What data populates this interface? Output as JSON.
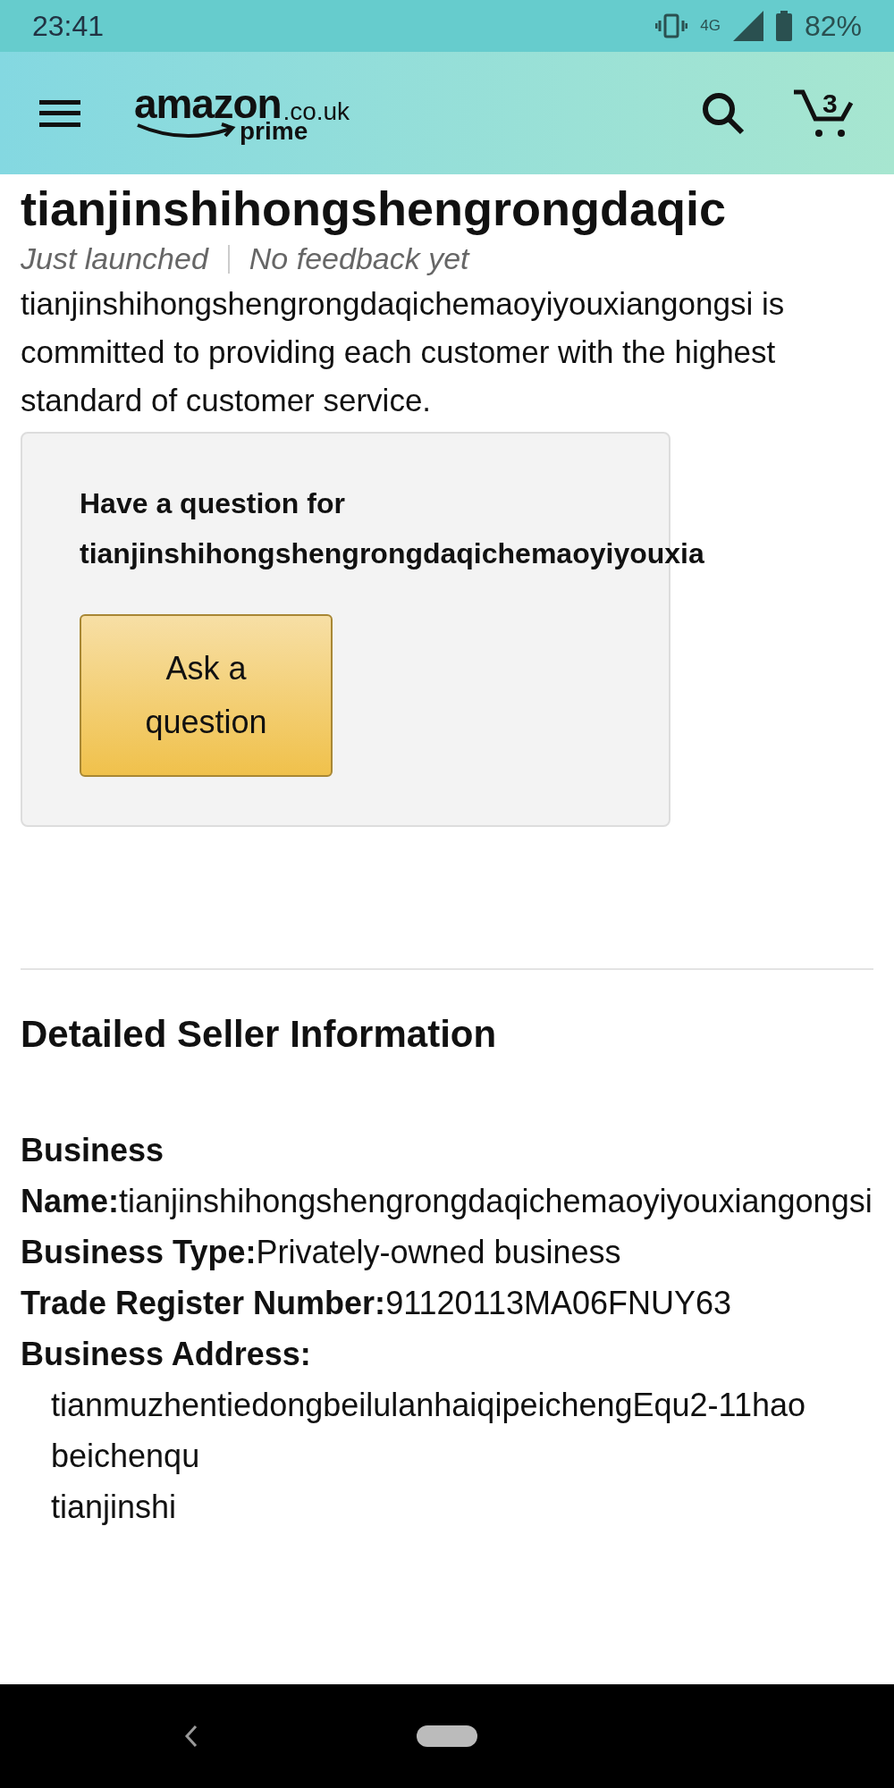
{
  "status_bar": {
    "time": "23:41",
    "network": "4G",
    "battery": "82%"
  },
  "header": {
    "logo": "amazon",
    "logo_domain": ".co.uk",
    "logo_sub": "prime",
    "cart_count": "3"
  },
  "seller": {
    "title": "tianjinshihongshengrongdaqic",
    "ratings": [
      "Just launched",
      "No feedback yet"
    ],
    "description": "tianjinshihongshengrongdaqichemaoyiyouxiangongsi is committed to providing each customer with the highest standard of customer service."
  },
  "question_box": {
    "prompt": "Have a question for tianjinshihongshengrongdaqichemaoyiyouxia",
    "button": "Ask a question"
  },
  "details": {
    "heading": "Detailed Seller Information",
    "fields": [
      "**Business Name:**tianjinshihongshengrongdaqichemaoyiyouxiangongsi",
      "**Business Type:**Privately-owned business",
      "**Trade Register Number:**91120113MA06FNUY63",
      "**Business Address:**"
    ],
    "address": [
      "tianmuzhentiedongbeilulanhaiqipeichengEqu2-11hao",
      "beichenqu",
      "tianjinshi"
    ]
  }
}
